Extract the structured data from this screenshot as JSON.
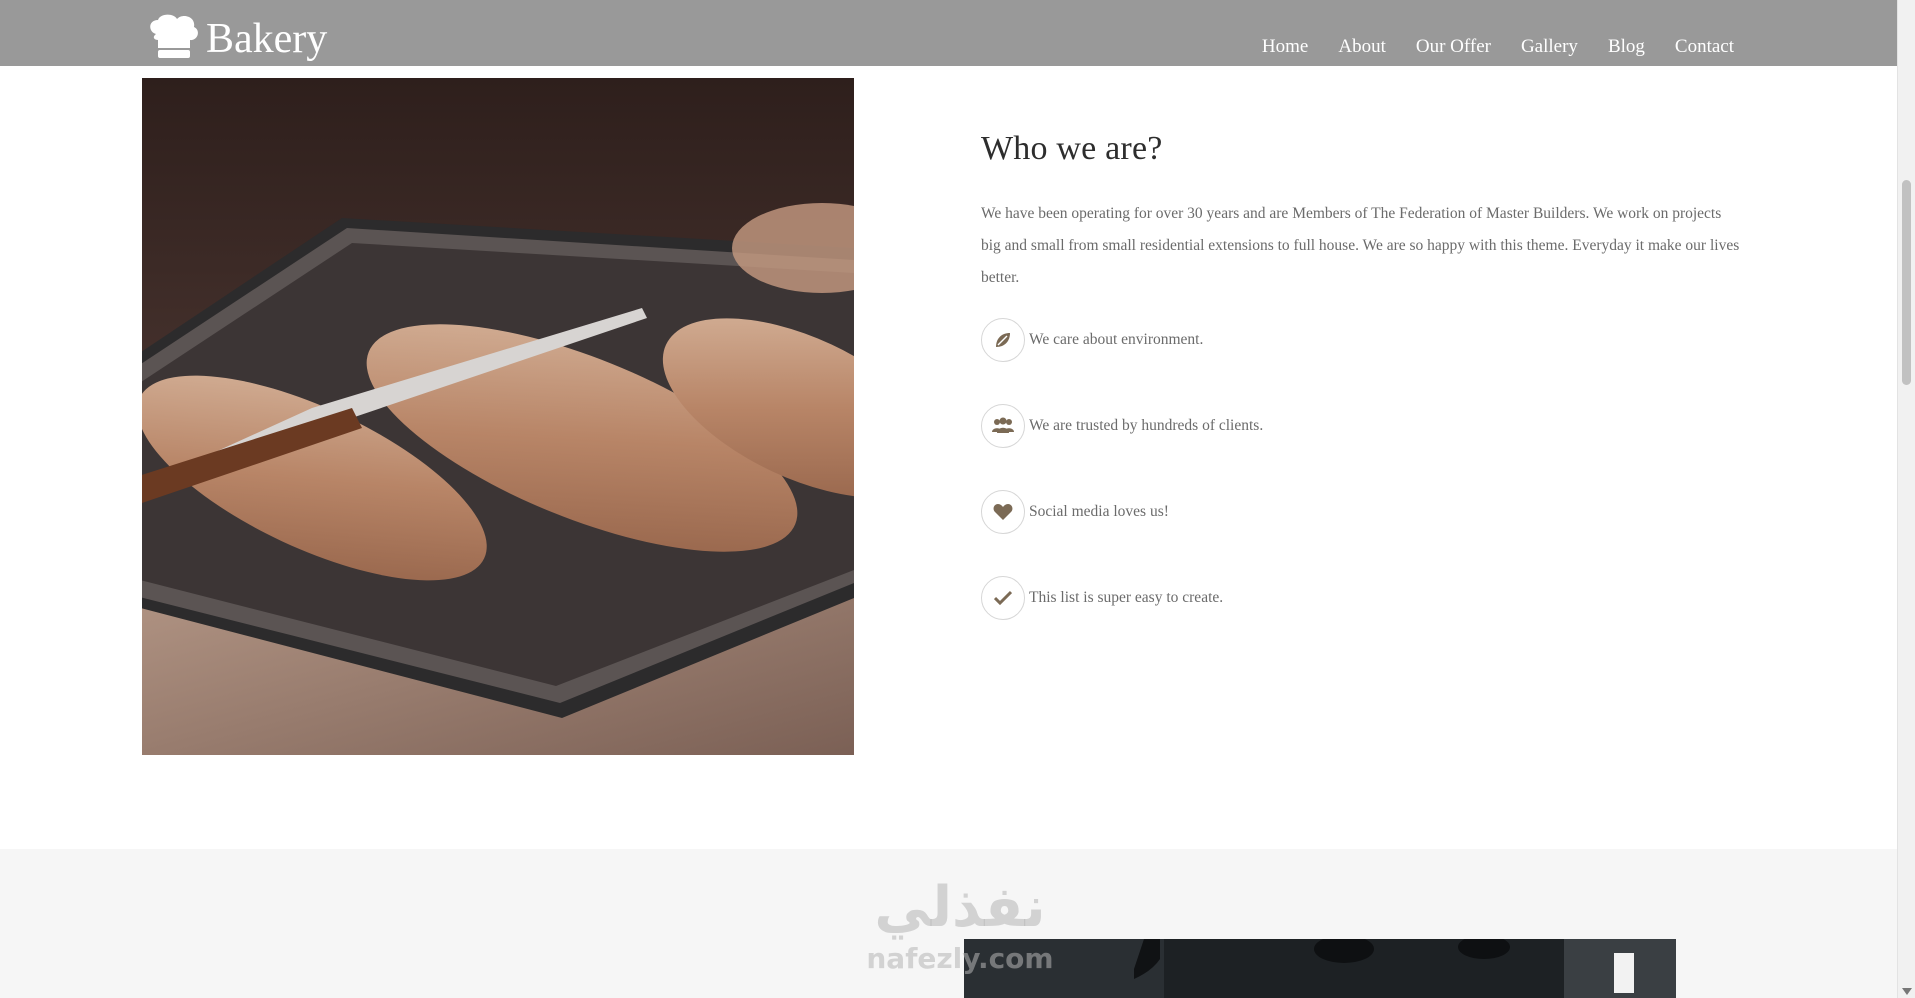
{
  "brand": {
    "name": "Bakery",
    "logo_icon": "chef-hat-icon"
  },
  "nav": {
    "items": [
      "Home",
      "About",
      "Our Offer",
      "Gallery",
      "Blog",
      "Contact"
    ]
  },
  "about": {
    "title": "Who we are?",
    "body": "We have been operating for over 30 years and are Members of The Federation of Master Builders. We work on projects big and small from small residential extensions to full house. We are so happy with this theme. Everyday it make our lives better.",
    "features": [
      {
        "icon": "leaf-icon",
        "text": "We care about environment."
      },
      {
        "icon": "users-icon",
        "text": "We are trusted by hundreds of clients."
      },
      {
        "icon": "heart-icon",
        "text": "Social media loves us!"
      },
      {
        "icon": "check-icon",
        "text": "This list is super easy to create."
      }
    ]
  },
  "watermark": {
    "arabic": "نفذلي",
    "latin": "nafezly.com"
  },
  "colors": {
    "header_bg": "#999999",
    "accent_icon": "#7b6a55",
    "band_bg": "#f6f6f6"
  }
}
